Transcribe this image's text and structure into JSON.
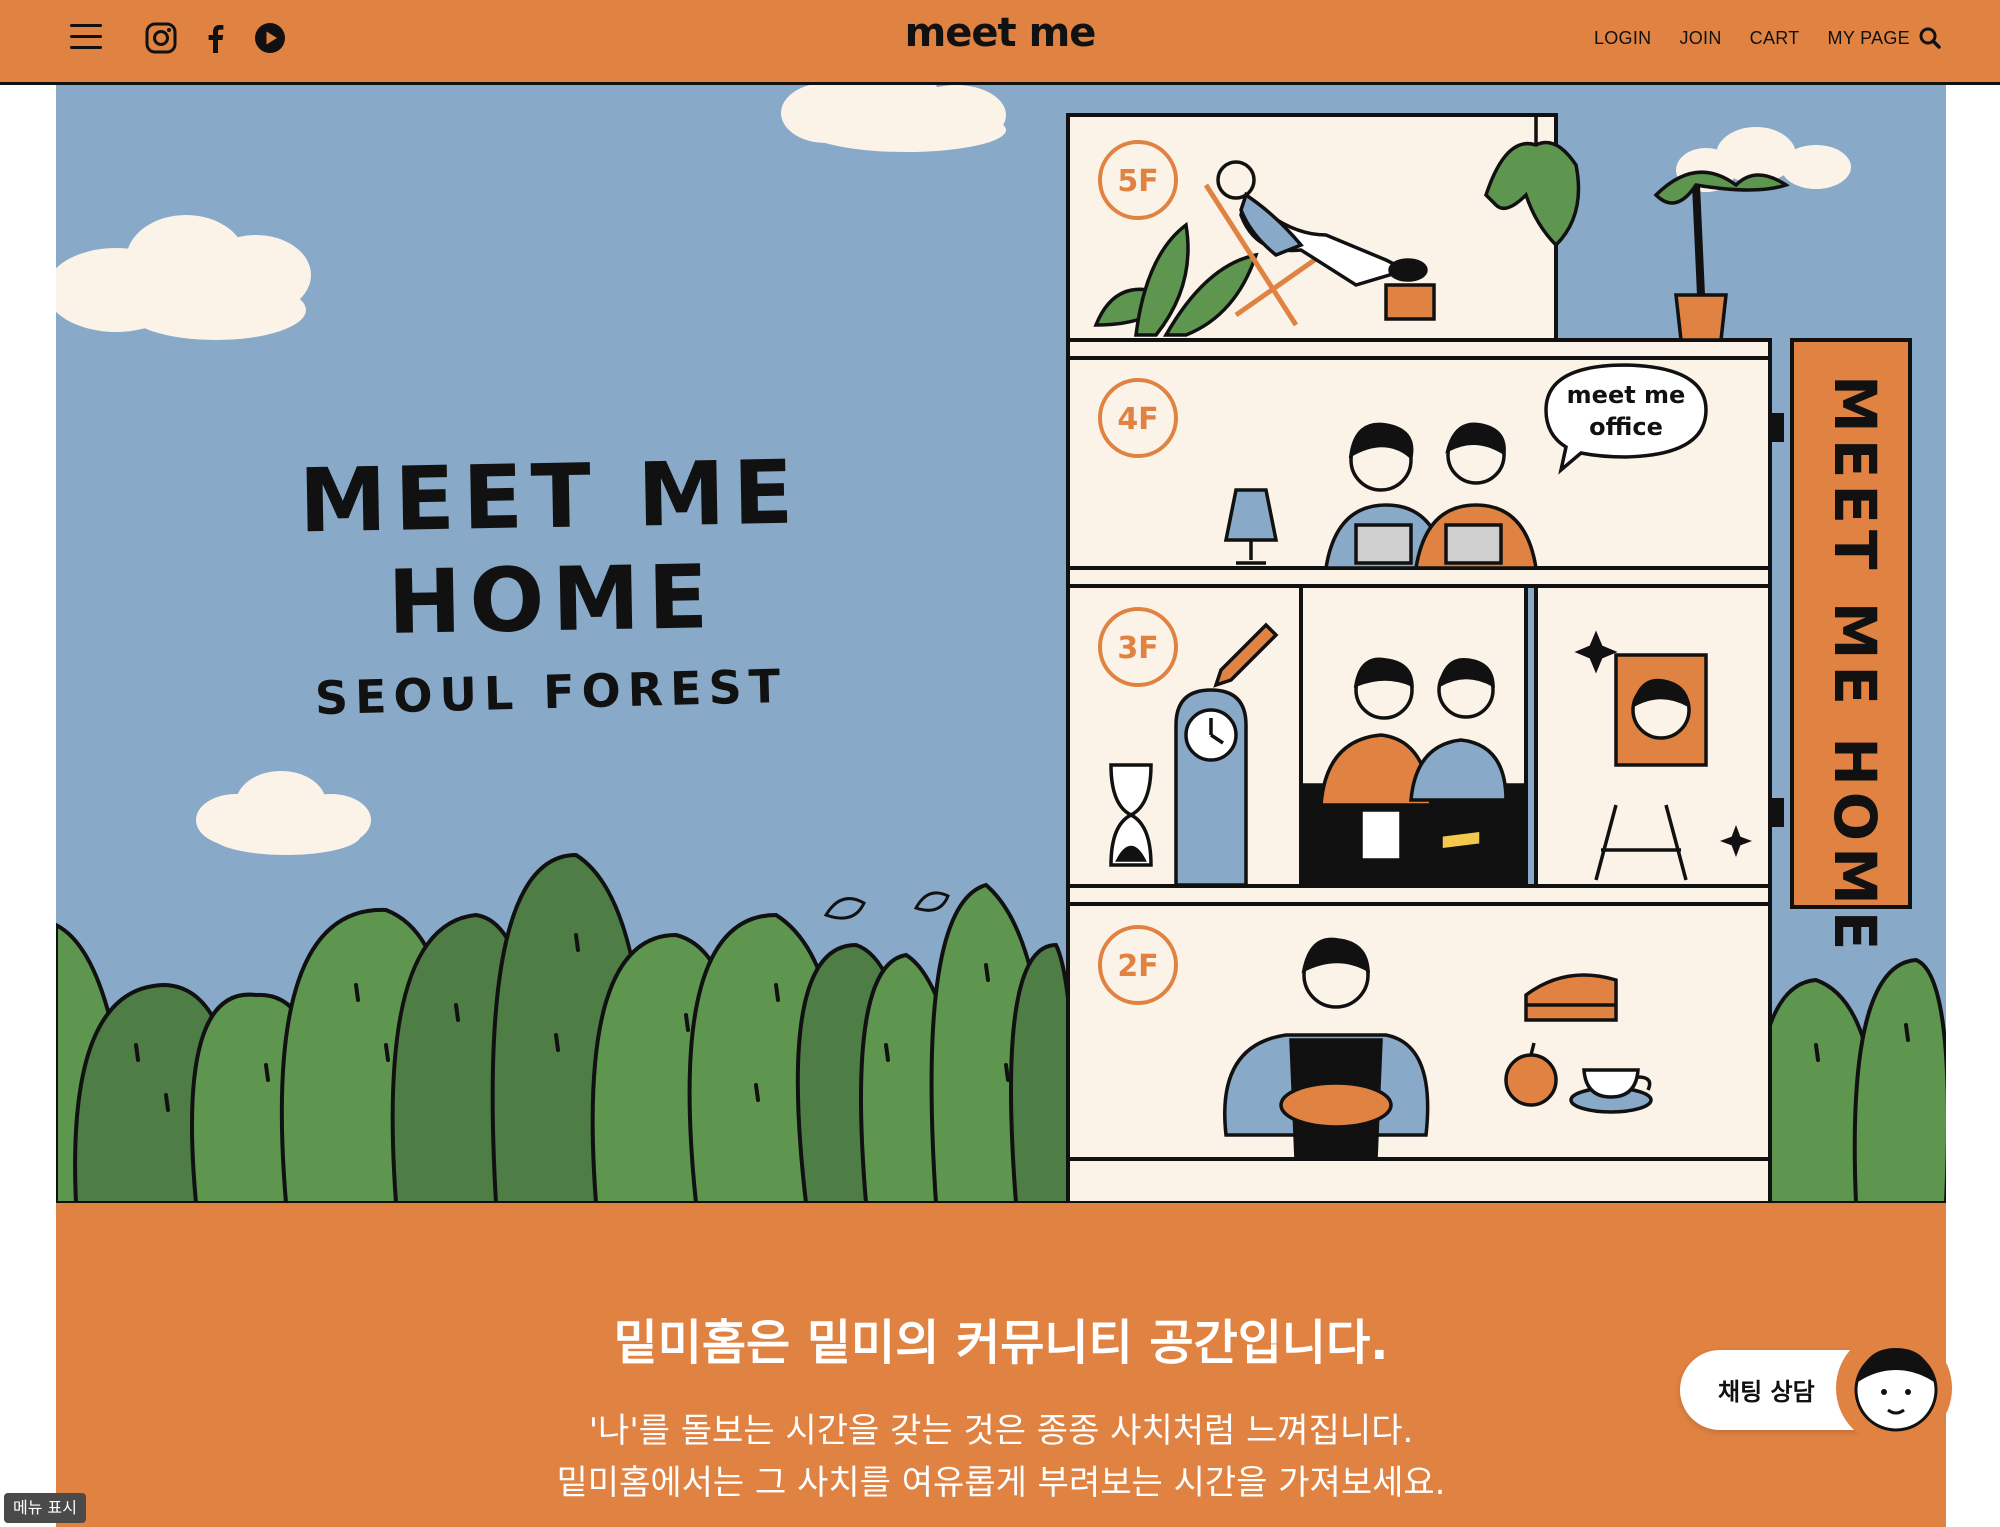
{
  "header": {
    "logo": "meet me",
    "nav": {
      "login": "LOGIN",
      "join": "JOIN",
      "cart": "CART",
      "mypage": "MY PAGE"
    },
    "icons": [
      "menu-icon",
      "instagram-icon",
      "facebook-icon",
      "youtube-icon",
      "search-icon"
    ]
  },
  "hero": {
    "title": "MEET ME HOME",
    "subtitle": "SEOUL FOREST",
    "floors": [
      "5F",
      "4F",
      "3F",
      "2F"
    ],
    "speech_bubble": {
      "line1": "meet me",
      "line2": "office"
    },
    "vertical_sign": "MEET ME HOME"
  },
  "intro": {
    "heading": "밑미홈은 밑미의 커뮤니티 공간입니다.",
    "line1": "'나'를 돌보는 시간을 갖는 것은 종종 사치처럼 느껴집니다.",
    "line2": "밑미홈에서는 그 사치를 여유롭게 부려보는 시간을 가져보세요."
  },
  "chat": {
    "label": "채팅 상담"
  },
  "menu_tooltip": "메뉴 표시",
  "colors": {
    "brand_orange": "#E08242",
    "sky": "#89A9C8",
    "cream": "#FBF3E8",
    "tree_dark": "#4E7E45",
    "tree_light": "#5E9650"
  }
}
